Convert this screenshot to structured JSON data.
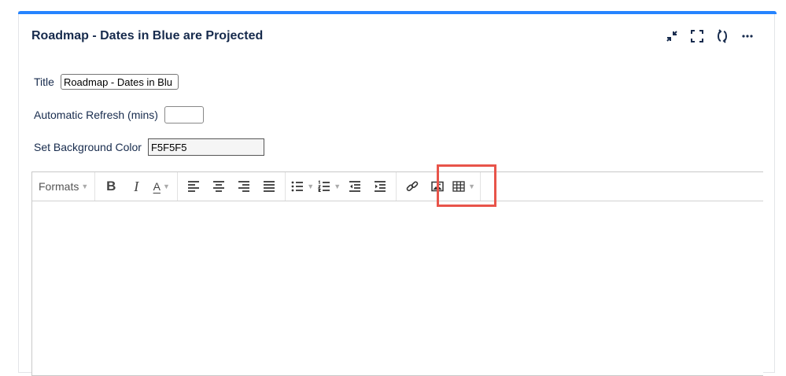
{
  "panel": {
    "title": "Roadmap - Dates in Blue are Projected",
    "accent_color": "#2684ff",
    "actions": [
      "minimize-icon",
      "expand-icon",
      "refresh-icon",
      "more-icon"
    ]
  },
  "form": {
    "title_label": "Title",
    "title_value": "Roadmap - Dates in Blu",
    "refresh_label": "Automatic Refresh (mins)",
    "refresh_value": "",
    "bg_label": "Set Background Color",
    "bg_value": "F5F5F5"
  },
  "toolbar": {
    "formats_label": "Formats",
    "font_color_label": "A",
    "bold_label": "B",
    "italic_label": "I",
    "highlight_color": "#e8544a"
  }
}
